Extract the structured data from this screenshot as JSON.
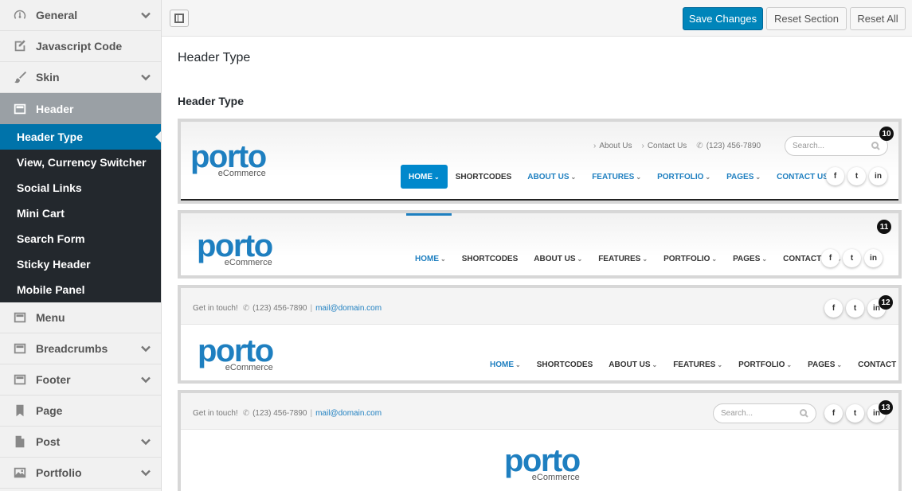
{
  "sidebar": {
    "items": [
      {
        "label": "General",
        "icon": "dashboard-icon",
        "chevron": true
      },
      {
        "label": "Javascript Code",
        "icon": "edit-icon",
        "chevron": false
      },
      {
        "label": "Skin",
        "icon": "brush-icon",
        "chevron": true
      },
      {
        "label": "Header",
        "icon": "layout-icon",
        "chevron": false,
        "active": true
      },
      {
        "label": "Menu",
        "icon": "layout-icon",
        "chevron": false
      },
      {
        "label": "Breadcrumbs",
        "icon": "layout-icon",
        "chevron": true
      },
      {
        "label": "Footer",
        "icon": "layout-icon",
        "chevron": true
      },
      {
        "label": "Page",
        "icon": "bookmark-icon",
        "chevron": false
      },
      {
        "label": "Post",
        "icon": "post-icon",
        "chevron": true
      },
      {
        "label": "Portfolio",
        "icon": "image-icon",
        "chevron": true
      }
    ],
    "submenu": [
      "Header Type",
      "View, Currency Switcher",
      "Social Links",
      "Mini Cart",
      "Search Form",
      "Sticky Header",
      "Mobile Panel"
    ]
  },
  "toolbar": {
    "save_label": "Save Changes",
    "reset_section_label": "Reset Section",
    "reset_all_label": "Reset All"
  },
  "main": {
    "section_title": "Header Type",
    "field_title": "Header Type"
  },
  "previews": {
    "logo_word": "porto",
    "logo_tag": "eCommerce",
    "nav": [
      "HOME",
      "SHORTCODES",
      "ABOUT US",
      "FEATURES",
      "PORTFOLIO",
      "PAGES",
      "CONTACT US"
    ],
    "about_link": "About Us",
    "contact_link": "Contact Us",
    "phone": "(123) 456-7890",
    "search_placeholder": "Search...",
    "get_in_touch": "Get in touch!",
    "separator": "|",
    "email": "mail@domain.com",
    "social": [
      "f",
      "t",
      "in"
    ],
    "badges": [
      "10",
      "11",
      "12",
      "13"
    ]
  },
  "colors": {
    "primary": "#0085ba",
    "submenu_bg": "#23282d",
    "submenu_active": "#0073aa",
    "porto_blue": "#1e7fc0"
  }
}
